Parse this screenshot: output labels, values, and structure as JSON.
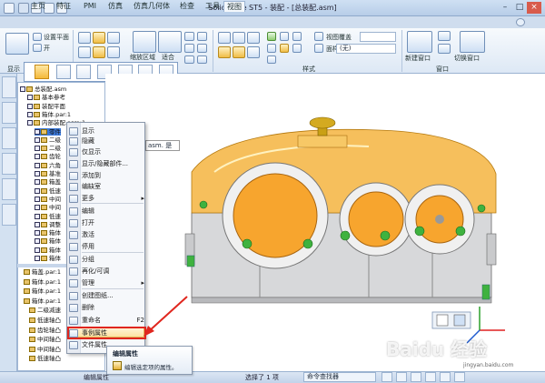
{
  "app": {
    "title": "Solid Edge ST5 - 装配 - [总装配.asm]"
  },
  "quick_access": [
    "save-icon",
    "undo-icon",
    "redo-icon",
    "print-icon"
  ],
  "window_controls": [
    "minimize-icon",
    "restore-icon",
    "close-icon"
  ],
  "tabs": [
    {
      "label": "主页"
    },
    {
      "label": "特征"
    },
    {
      "label": "PMI"
    },
    {
      "label": "仿真"
    },
    {
      "label": "仿真几何体"
    },
    {
      "label": "检查"
    },
    {
      "label": "工具"
    },
    {
      "label": "视图"
    }
  ],
  "active_tab": "视图",
  "ribbon": {
    "show_group_label": "显示",
    "style_group_label": "样式",
    "window_group_label": "窗口",
    "cut_plane_label": "设置平面",
    "open_label": "开",
    "zoom_area_label": "缩放区域",
    "fit_label": "适合",
    "view_overlay_label": "视图覆盖",
    "face_style_label": "面样式",
    "face_style_value": "(无)",
    "new_window_label": "新建窗口",
    "switch_window_label": "切换窗口"
  },
  "tree": {
    "items": [
      {
        "label": "总装配.asm"
      },
      {
        "label": "基本参考"
      },
      {
        "label": "装配平面"
      },
      {
        "label": "箱体.par:1"
      },
      {
        "label": "内部装配.asm:1"
      },
      {
        "label": "零件"
      },
      {
        "label": "二级"
      },
      {
        "label": "二级"
      },
      {
        "label": "齿轮"
      },
      {
        "label": "六角"
      },
      {
        "label": "基准"
      },
      {
        "label": "箱盖"
      },
      {
        "label": "低速"
      },
      {
        "label": "中间"
      },
      {
        "label": "中间"
      },
      {
        "label": "低速"
      },
      {
        "label": "调整"
      },
      {
        "label": "箱体"
      },
      {
        "label": "箱体"
      },
      {
        "label": "箱体"
      },
      {
        "label": "箱体"
      }
    ],
    "lower_items": [
      {
        "label": "箱盖.par:1"
      },
      {
        "label": "箱体.par:1"
      },
      {
        "label": "箱体.par:1"
      },
      {
        "label": "箱体.par:1"
      },
      {
        "label": "二级减速"
      },
      {
        "label": "低速轴凸"
      },
      {
        "label": "齿轮轴凸"
      },
      {
        "label": "中间轴凸"
      },
      {
        "label": "中间轴凸"
      },
      {
        "label": "低速轴凸"
      }
    ]
  },
  "context_menu": {
    "items": [
      {
        "label": "显示"
      },
      {
        "label": "隐藏"
      },
      {
        "label": "仅显示"
      },
      {
        "label": "显示/隐藏部件..."
      },
      {
        "label": "添加到"
      },
      {
        "label": "编缺室"
      },
      {
        "label": "更多"
      },
      {
        "label": "编辑"
      },
      {
        "label": "打开"
      },
      {
        "label": "激活"
      },
      {
        "label": "停用"
      },
      {
        "label": "分组"
      },
      {
        "label": "再化/可调"
      },
      {
        "label": "管理"
      },
      {
        "label": "创建图纸..."
      },
      {
        "label": "删除"
      },
      {
        "label": "重命名"
      },
      {
        "label": "事例属性"
      },
      {
        "label": "文件属性"
      }
    ],
    "rename_shortcut": "F2",
    "highlighted": "事例属性"
  },
  "tooltip": {
    "title": "编辑属性",
    "body": "编辑选定项的属性。"
  },
  "hover_hint": {
    "text": "asm. 是"
  },
  "statusbar": {
    "left": "编辑属性",
    "selection": "选择了 1 项",
    "command_finder": "命令查找器"
  },
  "watermark": {
    "text": "Baidu 经验",
    "sub": "jingyan.baidu.com"
  },
  "colors": {
    "accent": "#f0a020",
    "cover": "#f5b84a",
    "body": "#d9d9d9",
    "highlight": "#e0261e"
  }
}
